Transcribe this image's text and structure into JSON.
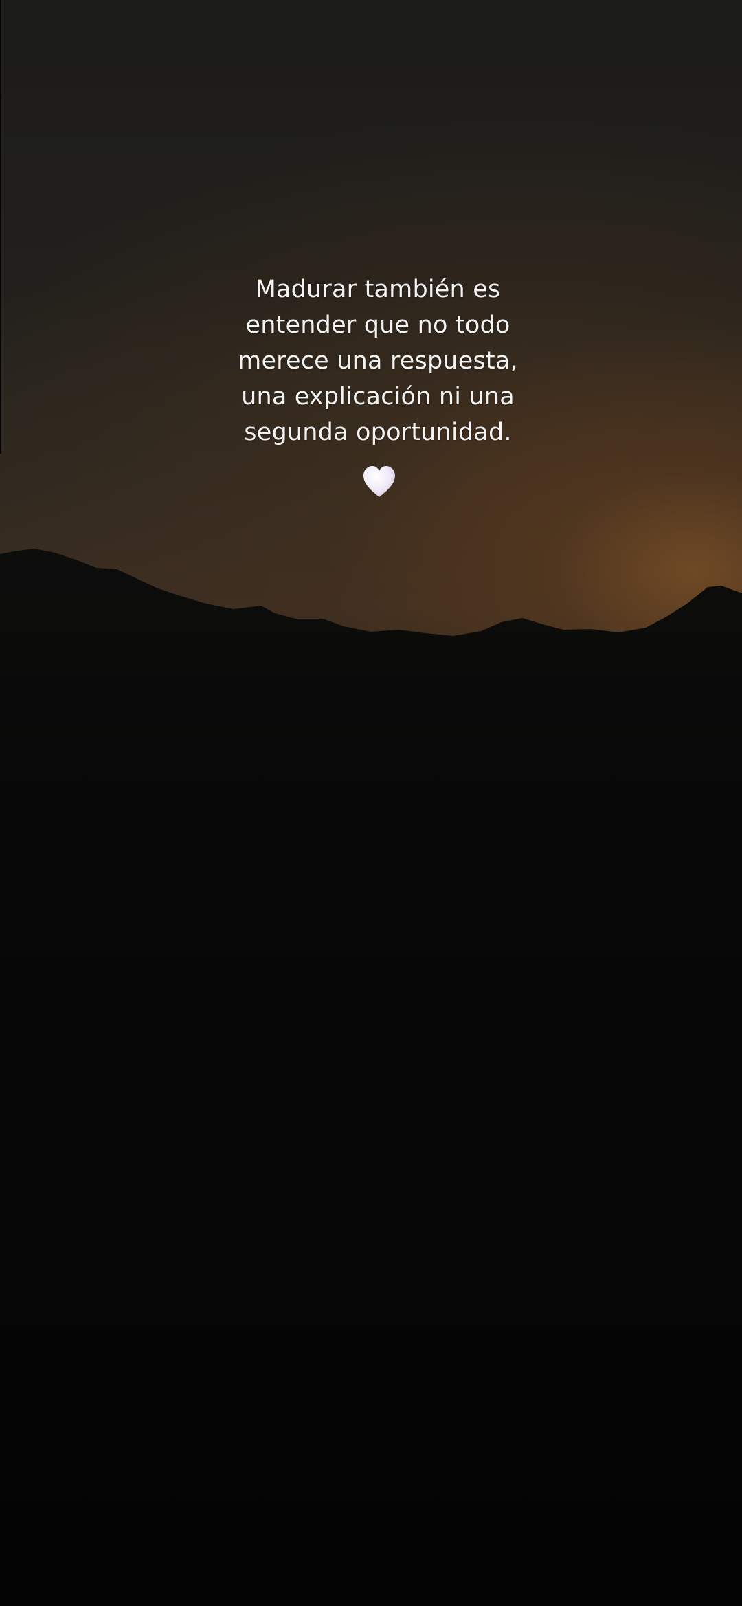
{
  "post": {
    "quote_text": "Madurar también es\nentender que no todo\nmerece una respuesta,\nuna explicación ni una\nsegunda oportunidad.",
    "emoji_icon": "white-heart-icon"
  },
  "colors": {
    "sky_dark": "#1b1b19",
    "sky_glow": "#784e26",
    "mountain_silhouette": "#0a0a0a",
    "text": "#f4f4f4",
    "heart_fill": "#ece6f5"
  }
}
